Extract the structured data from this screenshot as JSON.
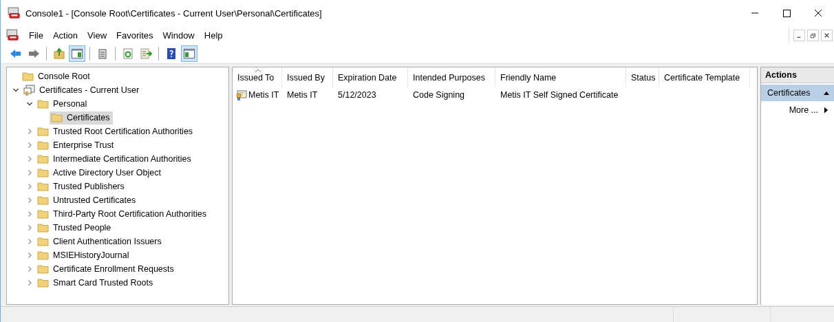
{
  "window": {
    "title": "Console1 - [Console Root\\Certificates - Current User\\Personal\\Certificates]"
  },
  "menu": [
    "File",
    "Action",
    "View",
    "Favorites",
    "Window",
    "Help"
  ],
  "toolbar": [
    {
      "kind": "back",
      "pressed": false
    },
    {
      "kind": "forward",
      "pressed": false
    },
    {
      "kind": "separator"
    },
    {
      "kind": "up",
      "pressed": false
    },
    {
      "kind": "tree",
      "pressed": true
    },
    {
      "kind": "separator"
    },
    {
      "kind": "properties",
      "pressed": false
    },
    {
      "kind": "separator"
    },
    {
      "kind": "refresh",
      "pressed": false
    },
    {
      "kind": "export",
      "pressed": false
    },
    {
      "kind": "separator"
    },
    {
      "kind": "help",
      "pressed": false
    },
    {
      "kind": "actionpane",
      "pressed": true
    }
  ],
  "tree": {
    "label": "Console Root",
    "kind": "folder",
    "selected": false,
    "children": [
      {
        "label": "Certificates - Current User",
        "kind": "snapin",
        "selected": false,
        "expanded": true,
        "children": [
          {
            "label": "Personal",
            "kind": "folder",
            "selected": false,
            "expanded": true,
            "children": [
              {
                "label": "Certificates",
                "kind": "folder",
                "selected": true
              }
            ]
          },
          {
            "label": "Trusted Root Certification Authorities",
            "kind": "folder",
            "selected": false,
            "expanded": false
          },
          {
            "label": "Enterprise Trust",
            "kind": "folder",
            "selected": false,
            "expanded": false
          },
          {
            "label": "Intermediate Certification Authorities",
            "kind": "folder",
            "selected": false,
            "expanded": false
          },
          {
            "label": "Active Directory User Object",
            "kind": "folder",
            "selected": false,
            "expanded": false
          },
          {
            "label": "Trusted Publishers",
            "kind": "folder",
            "selected": false,
            "expanded": false
          },
          {
            "label": "Untrusted Certificates",
            "kind": "folder",
            "selected": false,
            "expanded": false
          },
          {
            "label": "Third-Party Root Certification Authorities",
            "kind": "folder",
            "selected": false,
            "expanded": false
          },
          {
            "label": "Trusted People",
            "kind": "folder",
            "selected": false,
            "expanded": false
          },
          {
            "label": "Client Authentication Issuers",
            "kind": "folder",
            "selected": false,
            "expanded": false
          },
          {
            "label": "MSIEHistoryJournal",
            "kind": "folder",
            "selected": false,
            "expanded": false
          },
          {
            "label": "Certificate Enrollment Requests",
            "kind": "folder",
            "selected": false,
            "expanded": false
          },
          {
            "label": "Smart Card Trusted Roots",
            "kind": "folder",
            "selected": false,
            "expanded": false
          }
        ]
      }
    ]
  },
  "table": {
    "columns": [
      {
        "label": "Issued To",
        "sorted": true
      },
      {
        "label": "Issued By",
        "sorted": false
      },
      {
        "label": "Expiration Date",
        "sorted": false
      },
      {
        "label": "Intended Purposes",
        "sorted": false
      },
      {
        "label": "Friendly Name",
        "sorted": false
      },
      {
        "label": "Status",
        "sorted": false
      },
      {
        "label": "Certificate Template",
        "sorted": false
      }
    ],
    "rows": [
      {
        "cells": [
          "Metis IT",
          "Metis IT",
          "5/12/2023",
          "Code Signing",
          "Metis IT Self Signed Certificate"
        ]
      }
    ]
  },
  "actions": {
    "title": "Actions",
    "groups": [
      {
        "label": "Certificates",
        "expanded": true,
        "items": [
          {
            "label": "More ..."
          }
        ]
      }
    ]
  }
}
